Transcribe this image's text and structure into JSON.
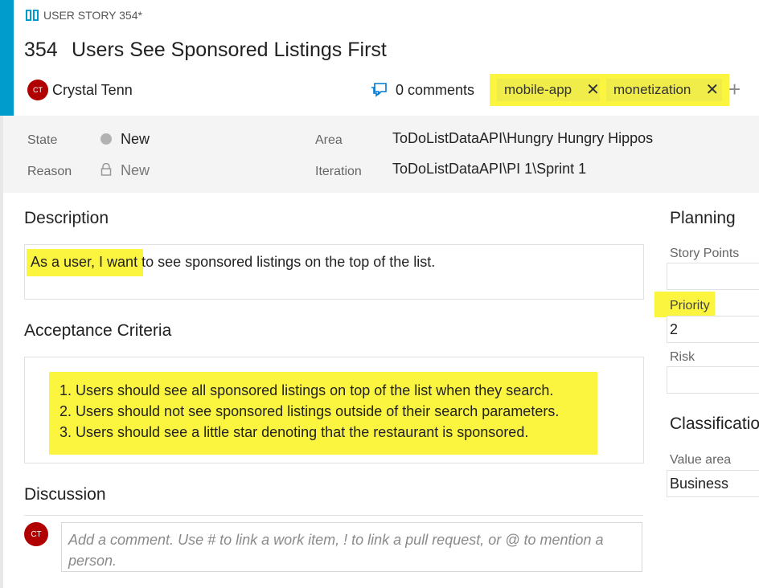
{
  "header": {
    "work_item_type": "USER STORY 354*",
    "id": "354",
    "title": "Users See Sponsored Listings First",
    "owner_initials": "CT",
    "owner_name": "Crystal Tenn",
    "comments": "0 comments",
    "tags": [
      "mobile-app",
      "monetization"
    ]
  },
  "fields": {
    "state_label": "State",
    "state_value": "New",
    "reason_label": "Reason",
    "reason_value": "New",
    "area_label": "Area",
    "area_value": "ToDoListDataAPI\\Hungry Hungry Hippos",
    "iteration_label": "Iteration",
    "iteration_value": "ToDoListDataAPI\\PI 1\\Sprint 1"
  },
  "description": {
    "heading": "Description",
    "text_highlighted": "As a user, I want",
    "text_rest": " to see sponsored listings on the top of the list."
  },
  "acceptance": {
    "heading": "Acceptance Criteria",
    "items": [
      "1. Users should see all sponsored listings on top of the list when they search.",
      "2. Users should not see sponsored listings outside of their search parameters.",
      "3. Users should see a little star denoting that the restaurant is sponsored."
    ]
  },
  "discussion": {
    "heading": "Discussion",
    "avatar_initials": "CT",
    "placeholder": "Add a comment. Use # to link a work item, ! to link a pull request, or @ to mention a person."
  },
  "planning": {
    "heading": "Planning",
    "story_points_label": "Story Points",
    "story_points_value": "",
    "priority_label": "Priority",
    "priority_value": "2",
    "risk_label": "Risk",
    "risk_value": ""
  },
  "classification": {
    "heading": "Classificatio",
    "value_area_label": "Value area",
    "value_area_value": "Business"
  },
  "colors": {
    "accent_bar": "#009ccc",
    "highlight": "#fbf53f",
    "avatar": "#b00000"
  }
}
